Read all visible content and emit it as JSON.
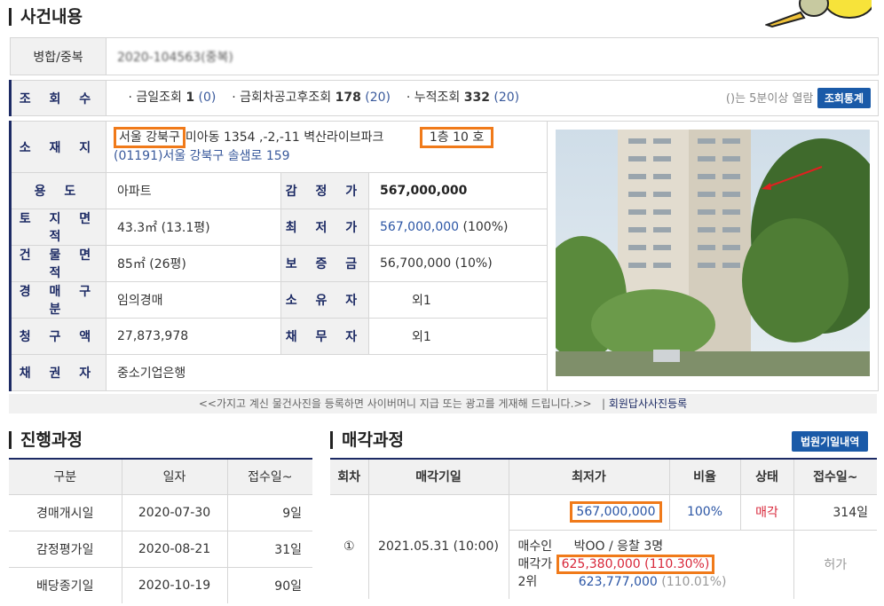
{
  "case_section": {
    "title": "사건내용"
  },
  "merge": {
    "label": "병합/중복",
    "value": "2020-104563(중복)"
  },
  "views": {
    "label": "조 회 수",
    "today_label": "· 금일조회",
    "today_value": "1",
    "today_paren": "(0)",
    "after_label": "· 금회차공고후조회",
    "after_value": "178",
    "after_paren": "(20)",
    "total_label": "· 누적조회",
    "total_value": "332",
    "total_paren": "(20)",
    "note": "()는 5분이상 열람",
    "stats_button": "조회통계"
  },
  "location": {
    "label": "소 재 지",
    "addr_highlight": "서울 강북구",
    "addr_rest": "미아동 1354 ,-2,-11 벽산라이브파크",
    "unit": "1층 10 호",
    "road_address": "(01191)서울 강북구  솔샘로  159"
  },
  "rows": {
    "use_label": "용      도",
    "use_value": "아파트",
    "appraisal_label": "감 정 가",
    "appraisal_value": "567,000,000",
    "land_label": "토 지 면 적",
    "land_value": "43.3㎡ (13.1평)",
    "min_label": "최 저 가",
    "min_value": "567,000,000",
    "min_pct": "(100%)",
    "bldg_label": "건 물 면 적",
    "bldg_value": "85㎡ (26평)",
    "deposit_label": "보 증 금",
    "deposit_value": "56,700,000 (10%)",
    "type_label": "경 매 구 분",
    "type_value": "임의경매",
    "owner_label": "소 유 자",
    "owner_value": "외1",
    "claim_label": "청 구 액",
    "claim_value": "27,873,978",
    "debtor_label": "채 무 자",
    "debtor_value": "외1",
    "creditor_label": "채 권 자",
    "creditor_value": "중소기업은행"
  },
  "notice": {
    "text": "<<가지고 계신 물건사진을 등록하면 사이버머니 지급 또는 광고를 게재해 드립니다.>>",
    "link": "회원답사사진등록"
  },
  "progress": {
    "title": "진행과정",
    "headers": [
      "구분",
      "일자",
      "접수일~"
    ],
    "rows": [
      [
        "경매개시일",
        "2020-07-30",
        "9일"
      ],
      [
        "감정평가일",
        "2020-08-21",
        "31일"
      ],
      [
        "배당종기일",
        "2020-10-19",
        "90일"
      ]
    ]
  },
  "sale": {
    "title": "매각과정",
    "button": "법원기일내역",
    "headers": [
      "회차",
      "매각기일",
      "최저가",
      "비율",
      "상태",
      "접수일~"
    ],
    "round": "①",
    "date": "2021.05.31 (10:00)",
    "min_price": "567,000,000",
    "ratio": "100%",
    "status": "매각",
    "days": "314일",
    "buyer_label": "매수인",
    "buyer_value": "박OO  / 응찰 3명",
    "price_label": "매각가",
    "price_value": "625,380,000 (110.30%)",
    "second_label": "2위",
    "second_value": "623,777,000 (110.01%)",
    "permit": "허가"
  },
  "colors": {
    "navy": "#1c2a64",
    "accent_orange": "#f07a1a",
    "red": "#d8273a",
    "blue": "#2c56a5"
  }
}
